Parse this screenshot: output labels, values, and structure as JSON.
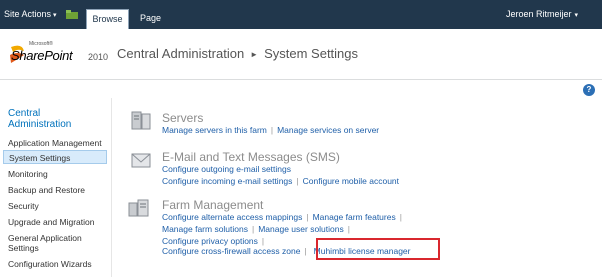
{
  "ribbon": {
    "site_actions": "Site Actions",
    "tabs": [
      "Browse",
      "Page"
    ],
    "user": "Jeroen Ritmeijer"
  },
  "logo": {
    "microsoft": "Microsoft®",
    "product": "SharePoint",
    "year": "2010"
  },
  "breadcrumb": {
    "root": "Central Administration",
    "current": "System Settings"
  },
  "help": {
    "label": "?"
  },
  "left_nav": {
    "heading": "Central Administration",
    "items": [
      "Application Management",
      "System Settings",
      "Monitoring",
      "Backup and Restore",
      "Security",
      "Upgrade and Migration",
      "General Application Settings",
      "Configuration Wizards"
    ],
    "selected": "System Settings"
  },
  "sections": [
    {
      "title": "Servers",
      "icon": "server-icon",
      "links": [
        [
          "Manage servers in this farm",
          "Manage services on server"
        ]
      ]
    },
    {
      "title": "E-Mail and Text Messages (SMS)",
      "icon": "email-icon",
      "links": [
        [
          "Configure outgoing e-mail settings"
        ],
        [
          "Configure incoming e-mail settings",
          "Configure mobile account"
        ]
      ]
    },
    {
      "title": "Farm Management",
      "icon": "farm-icon",
      "links": [
        [
          "Configure alternate access mappings",
          "Manage farm features"
        ],
        [
          "Manage farm solutions",
          "Manage user solutions"
        ],
        [
          "Configure privacy options"
        ],
        [
          "Configure cross-firewall access zone",
          "Muhimbi license manager"
        ]
      ]
    }
  ],
  "colors": {
    "ribbon": "#21374c",
    "link": "#1f5fa8",
    "highlight": "#d9272e",
    "nav_heading": "#0072bc"
  }
}
